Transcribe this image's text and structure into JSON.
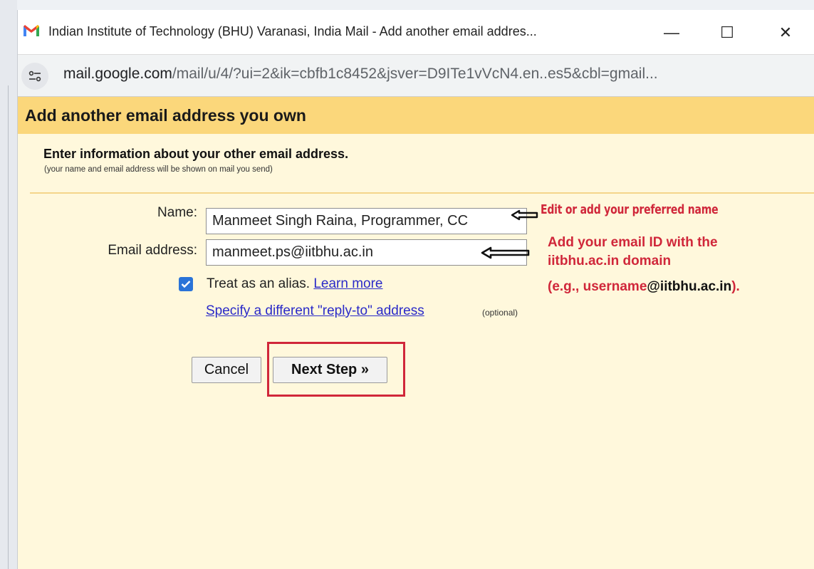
{
  "window": {
    "title": "Indian Institute of Technology (BHU) Varanasi, India Mail - Add another email addres...",
    "controls": {
      "minimize": "—",
      "maximize": "☐",
      "close": "✕"
    }
  },
  "address_bar": {
    "host": "mail.google.com",
    "path": "/mail/u/4/?ui=2&ik=cbfb1c8452&jsver=D9ITe1vVcN4.en..es5&cbl=gmail..."
  },
  "dialog": {
    "header_title": "Add another email address you own",
    "info_title": "Enter information about your other email address.",
    "info_subtitle": "(your name and email address will be shown on mail you send)",
    "name_label": "Name:",
    "name_value": "Manmeet Singh Raina, Programmer, CC",
    "email_label": "Email address:",
    "email_value": "manmeet.ps@iitbhu.ac.in",
    "alias_checked": true,
    "alias_text": "Treat as an alias.",
    "learn_more": "Learn more",
    "reply_to_link": "Specify a different \"reply-to\" address",
    "optional": "(optional)",
    "cancel_label": "Cancel",
    "next_label": "Next Step »"
  },
  "annotations": {
    "name_hint": "Edit or add your preferred name",
    "email_hint_line1": "Add your email ID with the",
    "email_hint_line2": "iitbhu.ac.in domain",
    "email_hint_line3_open": "(e.g., username",
    "email_hint_line3_dark": "@iitbhu.ac.in",
    "email_hint_line3_close": ")."
  },
  "colors": {
    "header_band": "#fbd77b",
    "page_background": "#fff8dc",
    "annotation_red": "#d0273a",
    "link_blue": "#2a2ac8",
    "checkbox_blue": "#2a73d8"
  }
}
